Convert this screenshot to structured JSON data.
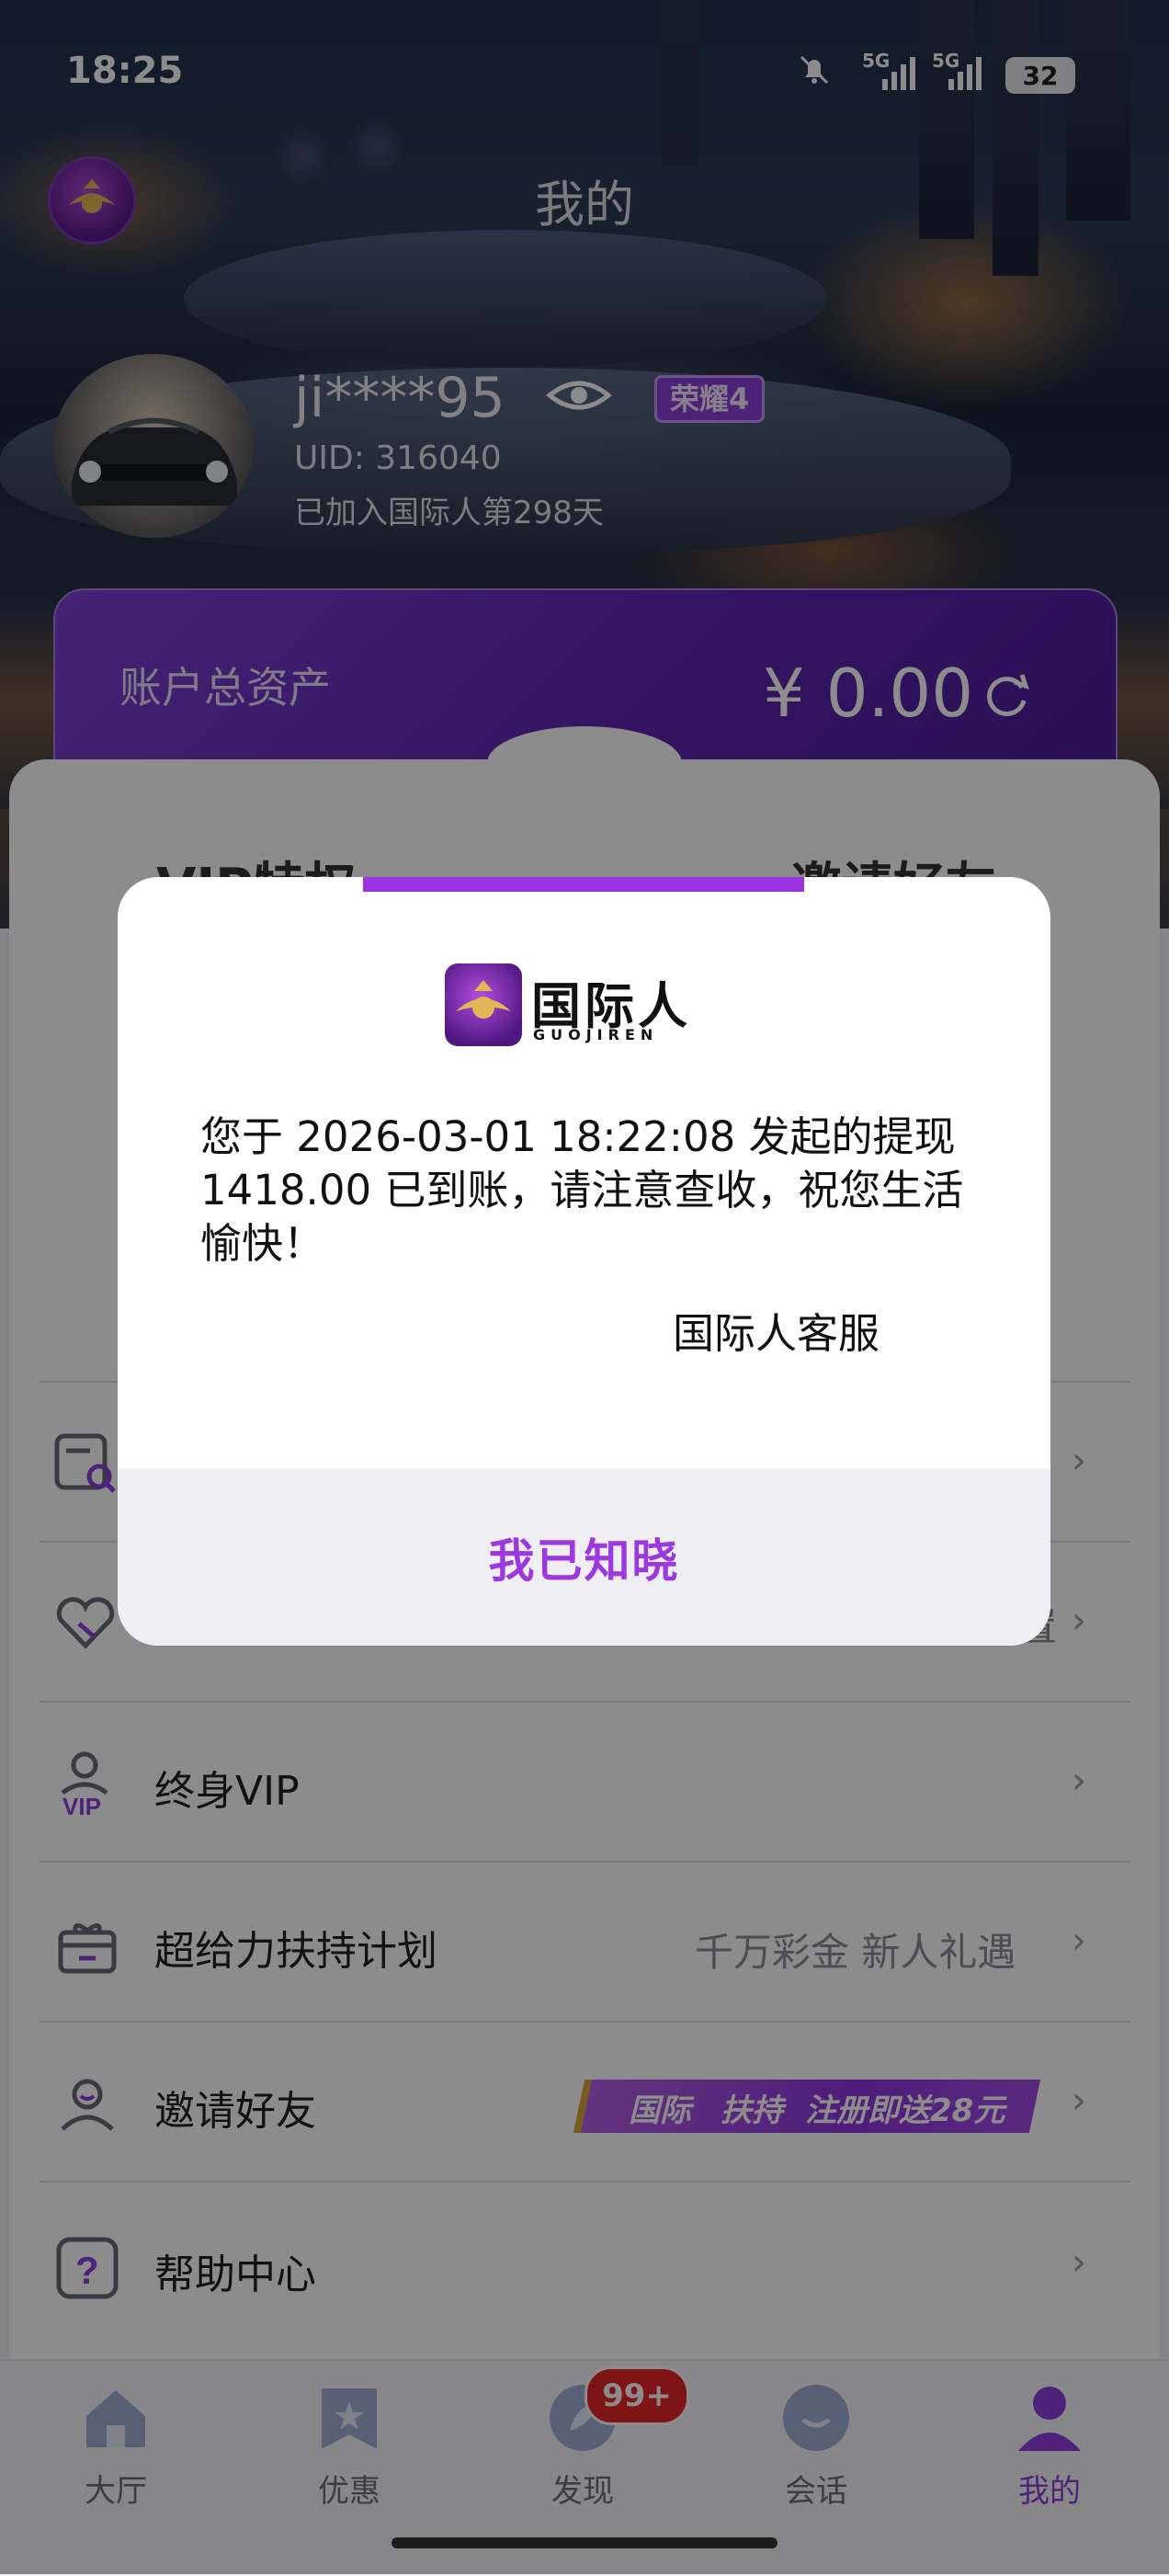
{
  "status_bar": {
    "time": "18:25",
    "battery": "32",
    "signal1": "5G",
    "signal2": "5G"
  },
  "header": {
    "title": "我的"
  },
  "profile": {
    "username": "ji****95",
    "badge": "荣耀4",
    "uid": "UID: 316040",
    "joined": "已加入国际人第298天"
  },
  "assets": {
    "label": "账户总资产",
    "amount": "¥ 0.00"
  },
  "quick_actions": [
    "VIP特权",
    "邀请好友"
  ],
  "modal": {
    "brand_cn": "国际人",
    "brand_en": "GUOJIREN",
    "message": "您于 2026-03-01 18:22:08 发起的提现1418.00 已到账，请注意查收，祝您生活愉快！",
    "signature": "国际人客服",
    "confirm": "我已知晓"
  },
  "menu": [
    {
      "label": "",
      "extra": "",
      "icon": "search-record-icon"
    },
    {
      "label": "",
      "extra": "置",
      "icon": "heart-icon"
    },
    {
      "label": "终身VIP",
      "extra": "",
      "icon": "vip-user-icon"
    },
    {
      "label": "超给力扶持计划",
      "extra": "千万彩金 新人礼遇",
      "icon": "gift-icon"
    },
    {
      "label": "邀请好友",
      "extra": "",
      "icon": "invite-friend-icon",
      "banner": {
        "part1": "国际",
        "part2": "扶持",
        "part3": "注册即送28元"
      }
    },
    {
      "label": "帮助中心",
      "extra": "",
      "icon": "help-icon"
    }
  ],
  "bottom_nav": {
    "items": [
      "大厅",
      "优惠",
      "发现",
      "会话",
      "我的"
    ],
    "badge": "99+"
  },
  "colors": {
    "accent": "#9b34e0",
    "purple_card": "#6a2bb8",
    "badge_red": "#e8262b"
  }
}
